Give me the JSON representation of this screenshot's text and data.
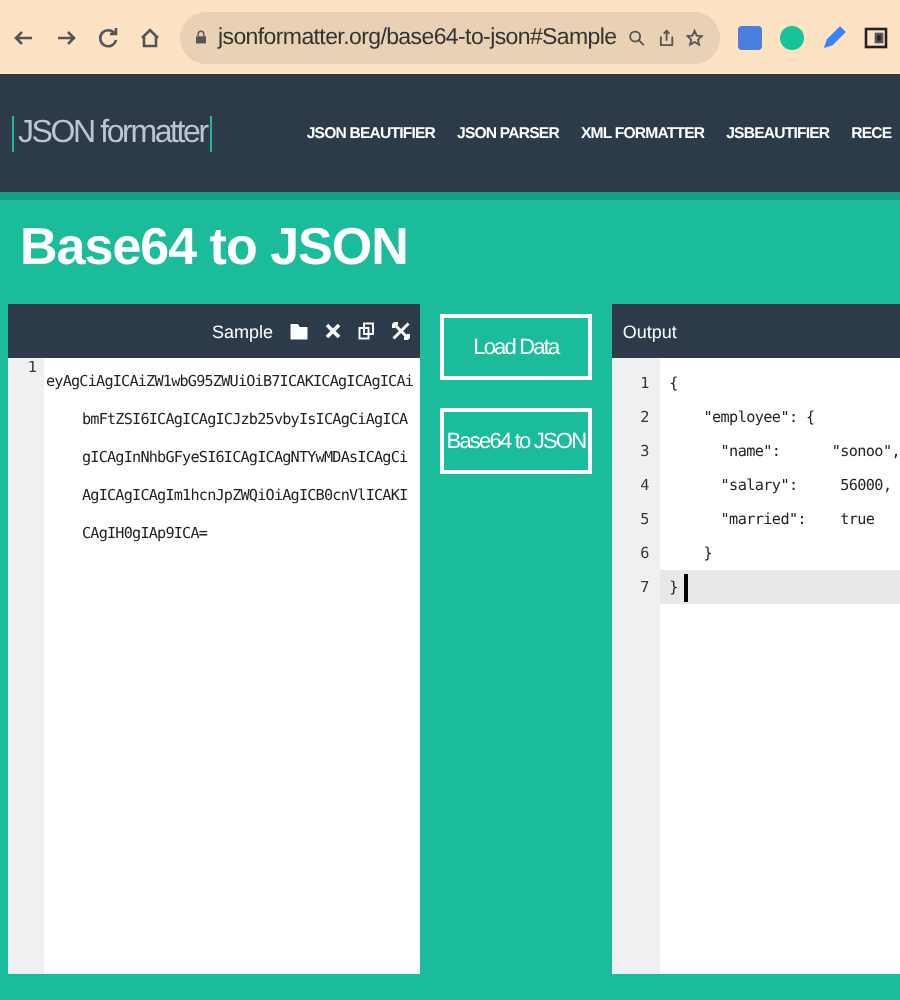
{
  "browser": {
    "url": "jsonformatter.org/base64-to-json#Sample"
  },
  "nav": {
    "logo": "JSON formatter",
    "items": [
      "JSON BEAUTIFIER",
      "JSON PARSER",
      "XML FORMATTER",
      "JSBEAUTIFIER",
      "RECE"
    ]
  },
  "title": "Base64 to JSON",
  "input_panel": {
    "sample_label": "Sample",
    "line_number": "1",
    "text": "eyAgCiAgICAiZW1wbG95ZWUiOiB7ICAKICAgICAgICAibmFtZSI6ICAgICAgICJzb25vbyIsICAgCiAgICAgICAgInNhbGFyeSI6ICAgICAgNTYwMDAsICAgCiAgICAgICAgIm1hcnJpZWQiOiAgICB0cnVlICAKICAgIH0gIAp9ICA="
  },
  "buttons": [
    "Load Data",
    "Base64 to JSON"
  ],
  "output_panel": {
    "title": "Output",
    "lines": [
      {
        "number": "1",
        "text": "{",
        "active": false
      },
      {
        "number": "2",
        "text": "    \"employee\": {",
        "active": false
      },
      {
        "number": "3",
        "text": "      \"name\":      \"sonoo\",",
        "active": false
      },
      {
        "number": "4",
        "text": "      \"salary\":     56000,",
        "active": false
      },
      {
        "number": "5",
        "text": "      \"married\":    true",
        "active": false
      },
      {
        "number": "6",
        "text": "    }",
        "active": false
      },
      {
        "number": "7",
        "text": "}",
        "active": true
      }
    ]
  }
}
